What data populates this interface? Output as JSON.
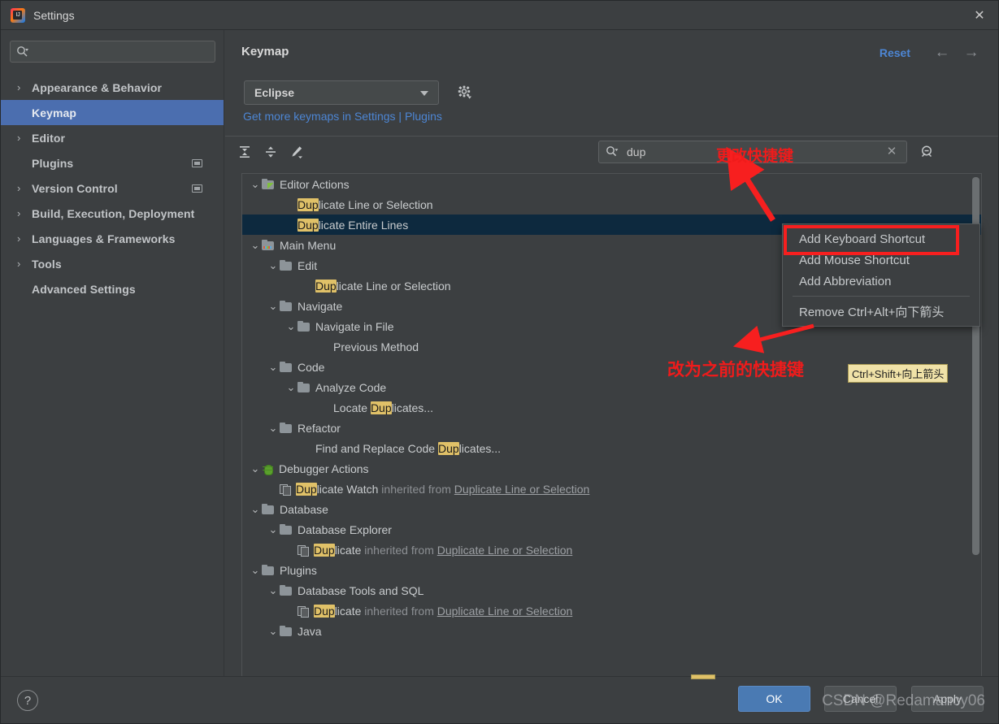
{
  "window": {
    "title": "Settings",
    "app_icon": "intellij-idea-icon",
    "close_icon": "close-icon"
  },
  "sidebar": {
    "search": {
      "value": "",
      "placeholder": "",
      "icon": "search-icon"
    },
    "items": [
      {
        "label": "Appearance & Behavior",
        "expandable": true,
        "selected": false,
        "badge": false
      },
      {
        "label": "Keymap",
        "expandable": false,
        "selected": true,
        "badge": false
      },
      {
        "label": "Editor",
        "expandable": true,
        "selected": false,
        "badge": false
      },
      {
        "label": "Plugins",
        "expandable": false,
        "selected": false,
        "badge": true
      },
      {
        "label": "Version Control",
        "expandable": true,
        "selected": false,
        "badge": true
      },
      {
        "label": "Build, Execution, Deployment",
        "expandable": true,
        "selected": false,
        "badge": false
      },
      {
        "label": "Languages & Frameworks",
        "expandable": true,
        "selected": false,
        "badge": false
      },
      {
        "label": "Tools",
        "expandable": true,
        "selected": false,
        "badge": false
      },
      {
        "label": "Advanced Settings",
        "expandable": false,
        "selected": false,
        "badge": false
      }
    ]
  },
  "header": {
    "title": "Keymap",
    "reset_label": "Reset",
    "back_icon": "arrow-left-icon",
    "forward_icon": "arrow-right-icon"
  },
  "keymap": {
    "selected_scheme": "Eclipse",
    "gear_icon": "gear-icon",
    "plugins_link_text": "Get more keymaps in Settings | Plugins",
    "toolbar": [
      {
        "icon": "expand-all-icon"
      },
      {
        "icon": "collapse-all-icon"
      },
      {
        "icon": "edit-shortcut-icon"
      }
    ],
    "search": {
      "value": "dup",
      "icon": "search-icon",
      "clear_icon": "close-icon",
      "find_shortcut_icon": "find-by-shortcut-icon"
    }
  },
  "tree": {
    "rows": [
      {
        "indent": 0,
        "chev": "v",
        "icon": "folder-editor",
        "text": "Editor Actions",
        "hl": ""
      },
      {
        "indent": 2,
        "chev": "",
        "icon": "none",
        "text": "Duplicate Line or Selection",
        "hl": "Dup"
      },
      {
        "indent": 2,
        "chev": "",
        "icon": "none",
        "text": "Duplicate Entire Lines",
        "hl": "Dup",
        "selected": true
      },
      {
        "indent": 0,
        "chev": "v",
        "icon": "folder-menu",
        "text": "Main Menu",
        "hl": ""
      },
      {
        "indent": 1,
        "chev": "v",
        "icon": "folder",
        "text": "Edit",
        "hl": ""
      },
      {
        "indent": 3,
        "chev": "",
        "icon": "none",
        "text": "Duplicate Line or Selection",
        "hl": "Dup"
      },
      {
        "indent": 1,
        "chev": "v",
        "icon": "folder",
        "text": "Navigate",
        "hl": ""
      },
      {
        "indent": 2,
        "chev": "v",
        "icon": "folder",
        "text": "Navigate in File",
        "hl": ""
      },
      {
        "indent": 4,
        "chev": "",
        "icon": "none",
        "text": "Previous Method",
        "hl": ""
      },
      {
        "indent": 1,
        "chev": "v",
        "icon": "folder",
        "text": "Code",
        "hl": ""
      },
      {
        "indent": 2,
        "chev": "v",
        "icon": "folder",
        "text": "Analyze Code",
        "hl": ""
      },
      {
        "indent": 4,
        "chev": "",
        "icon": "none",
        "text": "Locate Duplicates...",
        "hl": "Dup"
      },
      {
        "indent": 1,
        "chev": "v",
        "icon": "folder",
        "text": "Refactor",
        "hl": ""
      },
      {
        "indent": 3,
        "chev": "",
        "icon": "none",
        "text": "Find and Replace Code Duplicates...",
        "hl": "Dup"
      },
      {
        "indent": 0,
        "chev": "v",
        "icon": "bug",
        "text": "Debugger Actions",
        "hl": ""
      },
      {
        "indent": 1,
        "chev": "",
        "icon": "copy",
        "text": "Duplicate Watch",
        "hl": "Dup",
        "inherit": "inherited from",
        "inherit_link": "Duplicate Line or Selection"
      },
      {
        "indent": 0,
        "chev": "v",
        "icon": "folder",
        "text": "Database",
        "hl": ""
      },
      {
        "indent": 1,
        "chev": "v",
        "icon": "folder",
        "text": "Database Explorer",
        "hl": ""
      },
      {
        "indent": 2,
        "chev": "",
        "icon": "copy",
        "text": "Duplicate",
        "hl": "Dup",
        "inherit": "inherited from",
        "inherit_link": "Duplicate Line or Selection"
      },
      {
        "indent": 0,
        "chev": "v",
        "icon": "folder",
        "text": "Plugins",
        "hl": ""
      },
      {
        "indent": 1,
        "chev": "v",
        "icon": "folder",
        "text": "Database Tools and SQL",
        "hl": ""
      },
      {
        "indent": 2,
        "chev": "",
        "icon": "copy",
        "text": "Duplicate",
        "hl": "Dup",
        "inherit": "inherited from",
        "inherit_link": "Duplicate Line or Selection"
      },
      {
        "indent": 1,
        "chev": "v",
        "icon": "folder",
        "text": "Java",
        "hl": ""
      }
    ],
    "shortcut_badge": "Ctrl+Shift+向上箭头"
  },
  "context_menu": {
    "items": [
      {
        "label": "Add Keyboard Shortcut",
        "highlighted": true
      },
      {
        "label": "Add Mouse Shortcut",
        "highlighted": false
      },
      {
        "label": "Add Abbreviation",
        "highlighted": false
      },
      {
        "separator": true
      },
      {
        "label": "Remove Ctrl+Alt+向下箭头",
        "highlighted": false
      }
    ]
  },
  "annotations": [
    {
      "text": "更改快捷键",
      "color": "#f01b1b"
    },
    {
      "text": "改为之前的快捷键",
      "color": "#f01b1b"
    }
  ],
  "footer": {
    "help_label": "?",
    "ok_label": "OK",
    "cancel_label": "Cancel",
    "apply_label": "Apply"
  },
  "watermark": "CSDN @Redamancy06"
}
